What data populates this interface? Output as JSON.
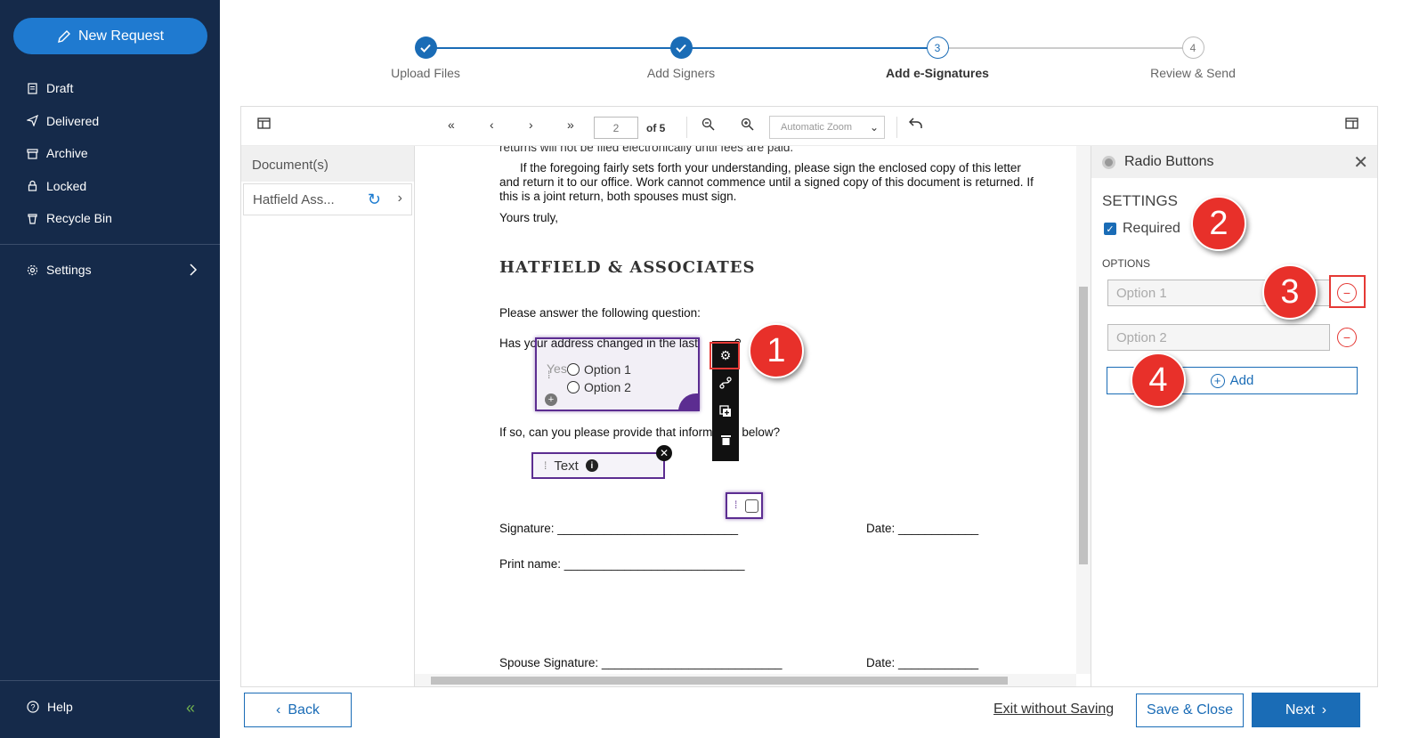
{
  "sidebar": {
    "new_request": "New Request",
    "items": [
      {
        "label": "Draft",
        "icon": "draft-icon"
      },
      {
        "label": "Delivered",
        "icon": "send-icon"
      },
      {
        "label": "Archive",
        "icon": "archive-icon"
      },
      {
        "label": "Locked",
        "icon": "lock-icon"
      },
      {
        "label": "Recycle Bin",
        "icon": "trash-icon"
      }
    ],
    "settings": "Settings",
    "help": "Help"
  },
  "stepper": {
    "steps": [
      {
        "label": "Upload Files",
        "state": "done"
      },
      {
        "label": "Add Signers",
        "state": "done"
      },
      {
        "label": "Add e-Signatures",
        "state": "active",
        "number": "3"
      },
      {
        "label": "Review & Send",
        "state": "todo",
        "number": "4"
      }
    ]
  },
  "toolbar": {
    "page": "2",
    "of_pages": "of 5",
    "zoom": "Automatic Zoom"
  },
  "documents": {
    "header": "Document(s)",
    "item": "Hatfield Ass..."
  },
  "page": {
    "line0": "returns will not be filed electronically until fees are paid.",
    "para1_l1": "If the foregoing fairly sets forth your understanding, please sign the enclosed copy of this letter",
    "para1_l2": "and return it to our office. Work cannot commence until a signed copy of this document is returned. If",
    "para1_l3": "this is a joint return, both spouses must sign.",
    "closing": "Yours truly,",
    "firm": "HATFIELD & ASSOCIATES",
    "question_intro": "Please answer the following question:",
    "question": "Has your address changed in the last",
    "question_tail": "?",
    "yes": "Yes",
    "followup": "If so, can you please provide that information below?",
    "signature": "Signature: ___________________________",
    "date1": "Date: ____________",
    "print_name": "Print name: ___________________________",
    "spouse_signature": "Spouse Signature: ___________________________",
    "date2": "Date: ____________"
  },
  "widgets": {
    "radio_options": [
      "Option 1",
      "Option 2"
    ],
    "text_field": "Text"
  },
  "annotations": [
    "1",
    "2",
    "3",
    "4"
  ],
  "panel": {
    "title": "Radio Buttons",
    "settings": "SETTINGS",
    "required": "Required",
    "options_label": "OPTIONS",
    "option_placeholders": [
      "Option 1",
      "Option 2"
    ],
    "add": "Add"
  },
  "footer": {
    "back": "Back",
    "exit": "Exit without Saving",
    "save_close": "Save & Close",
    "next": "Next"
  },
  "colors": {
    "sidebar": "#152a4a",
    "accent": "#1a6cb6",
    "widget": "#5c2d91",
    "callout": "#e8302a"
  }
}
